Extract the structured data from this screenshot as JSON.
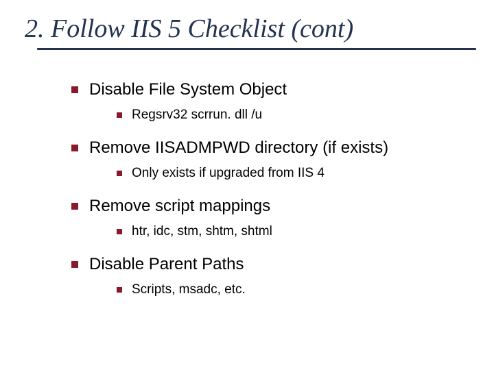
{
  "title": "2. Follow IIS 5 Checklist (cont)",
  "items": [
    {
      "label": "Disable File System Object",
      "sub": [
        "Regsrv32 scrrun. dll /u"
      ]
    },
    {
      "label": "Remove IISADMPWD directory (if exists)",
      "sub": [
        "Only exists if upgraded from IIS 4"
      ]
    },
    {
      "label": "Remove script mappings",
      "sub": [
        "htr, idc, stm, shtm, shtml"
      ]
    },
    {
      "label": "Disable Parent Paths",
      "sub": [
        "Scripts, msadc, etc."
      ]
    }
  ]
}
